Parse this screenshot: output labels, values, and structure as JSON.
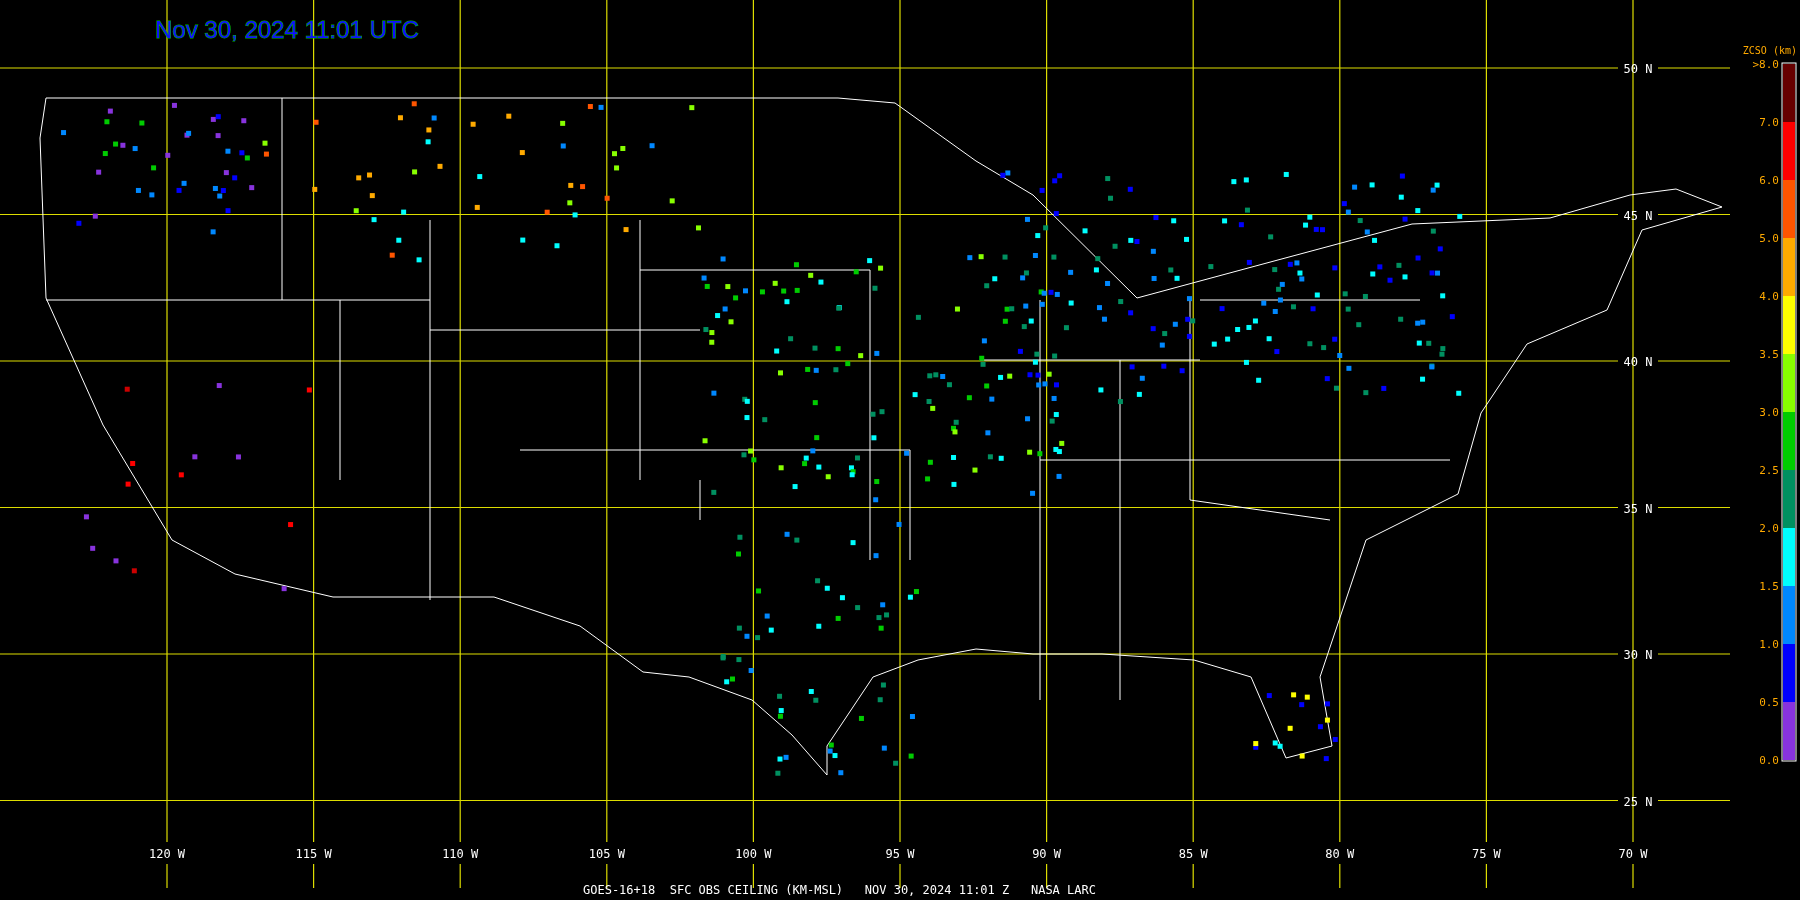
{
  "title": "Nov 30, 2024 11:01 UTC",
  "map": {
    "latitude_labels": [
      "50 N",
      "45 N",
      "40 N",
      "35 N",
      "30 N",
      "25 N"
    ],
    "longitude_labels": [
      "120 W",
      "115 W",
      "110 W",
      "105 W",
      "100 W",
      "95 W",
      "90 W",
      "85 W",
      "80 W",
      "75 W",
      "70 W"
    ]
  },
  "legend": {
    "title": "ZCSO (km)",
    "labels": [
      ">8.0",
      "7.0",
      "6.0",
      "5.0",
      "4.0",
      "3.5",
      "3.0",
      "2.5",
      "2.0",
      "1.5",
      "1.0",
      "0.5",
      "0.0"
    ],
    "segments": [
      {
        "color": "#660000"
      },
      {
        "color": "#ff0000"
      },
      {
        "color": "#ff5500"
      },
      {
        "color": "#ffaa00"
      },
      {
        "color": "#ffff00"
      },
      {
        "color": "#88ff00"
      },
      {
        "color": "#00cc00"
      },
      {
        "color": "#009060"
      },
      {
        "color": "#00ffff"
      },
      {
        "color": "#0088ff"
      },
      {
        "color": "#0000ff"
      },
      {
        "color": "#8833dd"
      }
    ]
  },
  "footer": "GOES-16+18  SFC OBS CEILING (KM-MSL)   NOV 30, 2024 11:01 Z   NASA LARC"
}
